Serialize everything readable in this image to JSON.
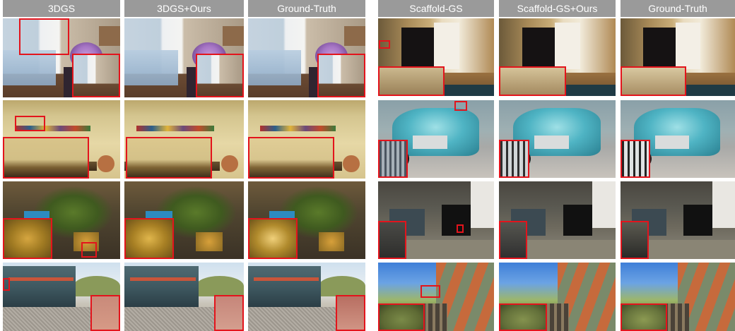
{
  "groups": [
    {
      "name": "3dgs-comparison",
      "headers": [
        "3DGS",
        "3DGS+Ours",
        "Ground-Truth"
      ]
    },
    {
      "name": "scaffold-comparison",
      "headers": [
        "Scaffold-GS",
        "Scaffold-GS+Ours",
        "Ground-Truth"
      ]
    }
  ],
  "colors": {
    "header_bg": "#9a9a9a",
    "header_text": "#ffffff",
    "highlight": "#e3141c"
  }
}
